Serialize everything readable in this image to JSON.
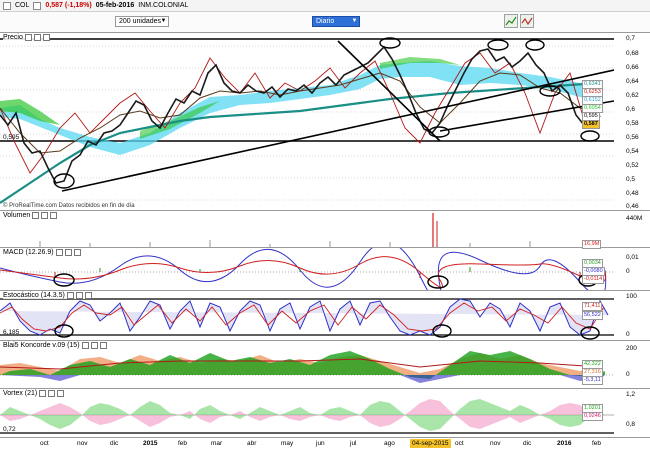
{
  "header": {
    "symbol": "COL",
    "change": "0,587 (-1,18%)",
    "date": "05-feb-2016",
    "name": "INM.COLONIAL"
  },
  "controls": {
    "units_select": "200 unidades",
    "period_select": "Diario"
  },
  "panels": {
    "price": {
      "title": "Precio",
      "left_label": "0,595",
      "credit": "© ProRealTime.com  Datos recibidos en fin de día",
      "axis": [
        "0,7",
        "0,68",
        "0,66",
        "0,64",
        "0,62",
        "0,6",
        "0,58",
        "0,56",
        "0,54",
        "0,52",
        "0,5",
        "0,48",
        "0,46"
      ],
      "tags": [
        "0,6341",
        "0,6253",
        "0,6152",
        "0,6054",
        "0,595",
        "0,587"
      ]
    },
    "volume": {
      "title": "Volumen",
      "axis": [
        "440M"
      ],
      "tags": [
        "16,9M"
      ]
    },
    "macd": {
      "title": "MACD (12.26.9)",
      "axis": [
        "0,01",
        "0"
      ],
      "tags": [
        "0,0034",
        "-0,0080",
        "-0,0114"
      ]
    },
    "stochastic": {
      "title": "Estocástico (14.3.5)",
      "left_label": "6,185",
      "axis": [
        "100",
        "0"
      ],
      "tags": [
        "71,411",
        "56,522"
      ]
    },
    "koncorde": {
      "title": "Blai5 Koncorde v.09 (15)",
      "axis": [
        "200",
        "0"
      ],
      "tags": [
        "42,322",
        "27,316",
        "-5,3,11"
      ]
    },
    "vortex": {
      "title": "Vortex (21)",
      "left_label": "0,72",
      "axis": [
        "1,2",
        "0,8"
      ],
      "tags": [
        "1,0201",
        "0,9246"
      ]
    }
  },
  "x_axis": {
    "months": [
      "oct",
      "nov",
      "dic",
      "2015",
      "feb",
      "mar",
      "abr",
      "may",
      "jun",
      "jul",
      "ago",
      "04-sep-2015",
      "oct",
      "nov",
      "dic",
      "2016",
      "feb"
    ],
    "highlighted": "04-sep-2015"
  },
  "colors": {
    "candles_up": "#1a1a1a",
    "ma_teal": "#1a8f86",
    "ma_red": "#b01818",
    "ichimoku_cyan": "#56d8f0",
    "ichimoku_green": "#2fc52f",
    "stoch_blue": "#3030c8",
    "stoch_red": "#d02020",
    "koncorde_orange": "#f0a070",
    "koncorde_green": "#1aa01a",
    "vortex_green": "#6fd36f",
    "vortex_pink": "#f2a0c8",
    "highlight_yellow": "#f3c22b"
  }
}
